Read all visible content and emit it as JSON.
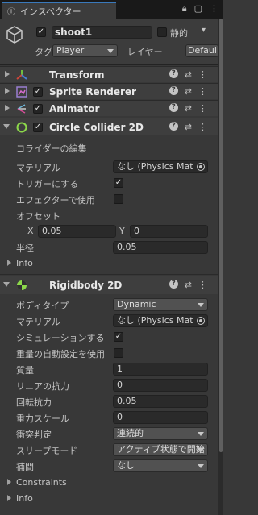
{
  "tab": {
    "title": "インスペクター"
  },
  "object": {
    "name": "shoot1",
    "static_label": "静的",
    "tag_label": "タグ",
    "tag_value": "Player",
    "layer_label": "レイヤー",
    "layer_value": "Defaul"
  },
  "components": {
    "transform": {
      "title": "Transform"
    },
    "sprite_renderer": {
      "title": "Sprite Renderer"
    },
    "animator": {
      "title": "Animator"
    },
    "circle_collider": {
      "title": "Circle Collider 2D",
      "edit_collider": "コライダーの編集",
      "material_label": "マテリアル",
      "material_value": "なし (Physics Mat",
      "trigger_label": "トリガーにする",
      "effector_label": "エフェクターで使用",
      "offset_label": "オフセット",
      "offset_x_label": "X",
      "offset_x": "0.05",
      "offset_y_label": "Y",
      "offset_y": "0",
      "radius_label": "半径",
      "radius": "0.05",
      "info": "Info"
    },
    "rigidbody": {
      "title": "Rigidbody 2D",
      "body_type_label": "ボディタイプ",
      "body_type": "Dynamic",
      "material_label": "マテリアル",
      "material_value": "なし (Physics Mat",
      "simulated_label": "シミュレーションする",
      "auto_mass_label": "重量の自動設定を使用",
      "mass_label": "質量",
      "mass": "1",
      "linear_drag_label": "リニアの抗力",
      "linear_drag": "0",
      "angular_drag_label": "回転抗力",
      "angular_drag": "0.05",
      "gravity_label": "重力スケール",
      "gravity": "0",
      "collision_label": "衝突判定",
      "collision": "連続的",
      "sleep_label": "スリープモード",
      "sleep": "アクティブ状態で開始",
      "interp_label": "補間",
      "interp": "なし",
      "constraints": "Constraints",
      "info": "Info"
    }
  },
  "checkmark": "✓",
  "colors": {
    "accent": "#3a79bb",
    "background": "#383838",
    "header": "#3e3e3e"
  }
}
